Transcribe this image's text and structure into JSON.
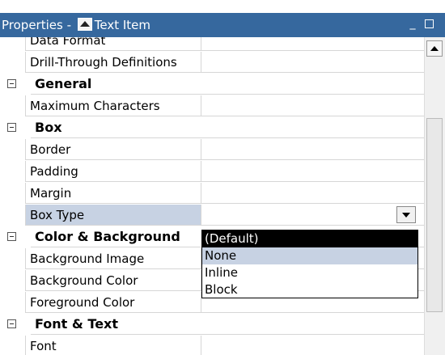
{
  "window": {
    "title_prefix": "Properties - ",
    "title_item": "Text Item",
    "minimize_label": "_"
  },
  "rows": [
    {
      "type": "prop",
      "name": "Data Format"
    },
    {
      "type": "prop",
      "name": "Drill-Through Definitions"
    },
    {
      "type": "category",
      "name": "General"
    },
    {
      "type": "prop",
      "name": "Maximum Characters"
    },
    {
      "type": "category",
      "name": "Box"
    },
    {
      "type": "prop",
      "name": "Border"
    },
    {
      "type": "prop",
      "name": "Padding"
    },
    {
      "type": "prop",
      "name": "Margin"
    },
    {
      "type": "prop",
      "name": "Box Type",
      "selected": true
    },
    {
      "type": "category",
      "name": "Color & Background"
    },
    {
      "type": "prop",
      "name": "Background Image"
    },
    {
      "type": "prop",
      "name": "Background Color"
    },
    {
      "type": "prop",
      "name": "Foreground Color"
    },
    {
      "type": "category",
      "name": "Font & Text"
    },
    {
      "type": "prop",
      "name": "Font"
    }
  ],
  "dropdown": {
    "options": [
      "(Default)",
      "None",
      "Inline",
      "Block"
    ],
    "highlighted": "(Default)",
    "selected": "None"
  },
  "colors": {
    "titlebar": "#36689e",
    "selection": "#c7d2e3"
  }
}
